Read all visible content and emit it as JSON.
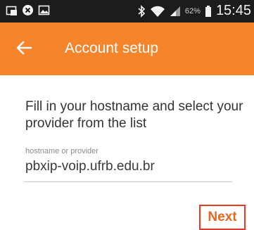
{
  "status_bar": {
    "icons": [
      "screenshot-icon",
      "close-circle-icon",
      "gallery-icon",
      "bluetooth-icon",
      "wifi-icon",
      "signal-icon",
      "battery-icon"
    ],
    "battery_text": "62%",
    "time": "15:45"
  },
  "app_bar": {
    "title": "Account setup",
    "back_icon": "arrow-left-icon",
    "color": "#f5842b"
  },
  "form": {
    "instructions": "Fill in your hostname and select your provider from the list",
    "hostname_label": "hostname or provider",
    "hostname_value": "pbxip-voip.ufrb.edu.br"
  },
  "actions": {
    "next_label": "Next",
    "highlight_color": "#e83a24"
  }
}
